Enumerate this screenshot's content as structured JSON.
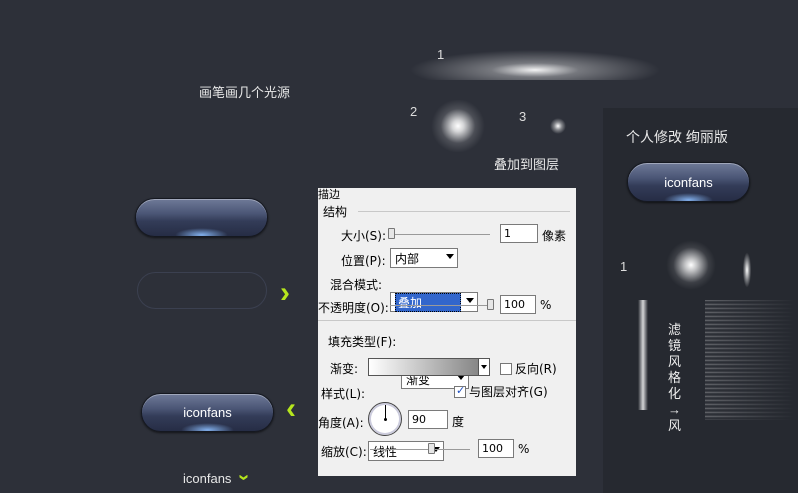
{
  "labels": {
    "n1": "1",
    "n2": "2",
    "n3": "3",
    "brush_title": "画笔画几个光源",
    "overlay": "叠加到图层",
    "personal": "个人修改 绚丽版",
    "right_n1": "1",
    "filter": "滤镜 风格化→风"
  },
  "buttons": {
    "left_pill_label": "iconfans",
    "right_pill_label": "iconfans",
    "bottom_label": "iconfans"
  },
  "dialog": {
    "title_frag": "描边",
    "group": "结构",
    "size_label": "大小(S):",
    "size_value": "1",
    "size_unit": "像素",
    "pos_label": "位置(P):",
    "pos_value": "内部",
    "blend_label": "混合模式:",
    "blend_value": "叠加",
    "opacity_label": "不透明度(O):",
    "opacity_value": "100",
    "opacity_unit": "%",
    "fill_label": "填充类型(F):",
    "fill_value": "渐变",
    "gradient_label": "渐变:",
    "reverse_label": "反向(R)",
    "style_label": "样式(L):",
    "style_value": "线性",
    "align_label": "与图层对齐(G)",
    "angle_label": "角度(A):",
    "angle_value": "90",
    "angle_unit": "度",
    "scale_label": "缩放(C):",
    "scale_value": "100",
    "scale_unit": "%"
  },
  "colors": {
    "background": "#2d3039",
    "accent_arrow": "#b5e51d",
    "blend_highlight": "#3266cc"
  }
}
